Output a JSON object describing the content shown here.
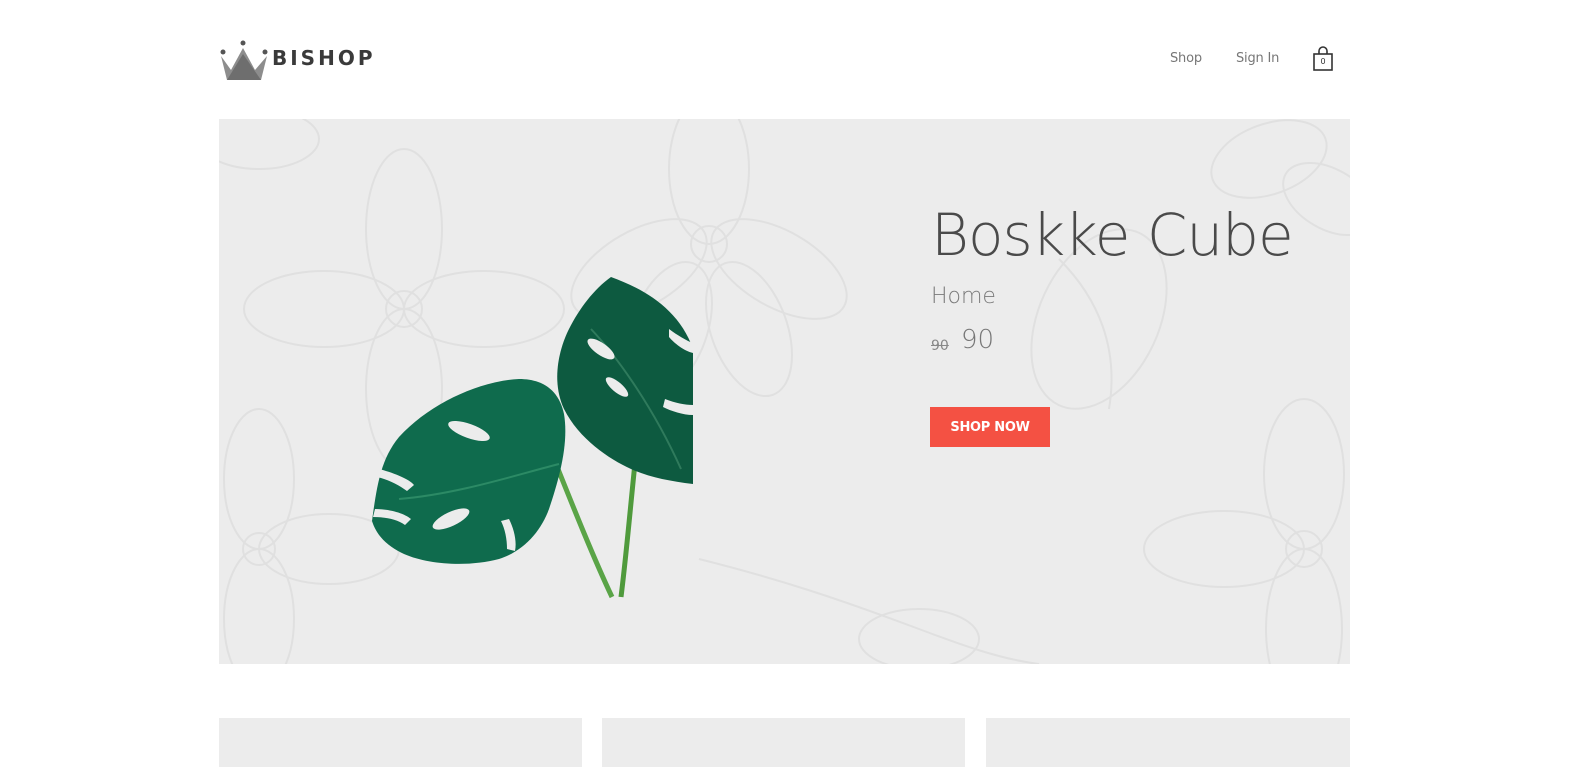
{
  "brand": {
    "name": "BISHOP",
    "logo_icon": "crown-icon"
  },
  "nav": {
    "shop_label": "Shop",
    "signin_label": "Sign In",
    "cart_icon": "shopping-bag-icon",
    "cart_count": "0"
  },
  "hero": {
    "title": "Boskke Cube",
    "category": "Home",
    "price_old": "90",
    "price_new": "90",
    "cta_label": "SHOP NOW",
    "image_icon": "monstera-leaf-image"
  },
  "colors": {
    "accent": "#f45143",
    "hero_background": "#ececec",
    "card_background": "#ececec",
    "text_dark": "#4a4a4a",
    "text_muted": "#777777"
  },
  "product_cards": [
    {
      "name": "product-card-1"
    },
    {
      "name": "product-card-2"
    },
    {
      "name": "product-card-3"
    }
  ]
}
